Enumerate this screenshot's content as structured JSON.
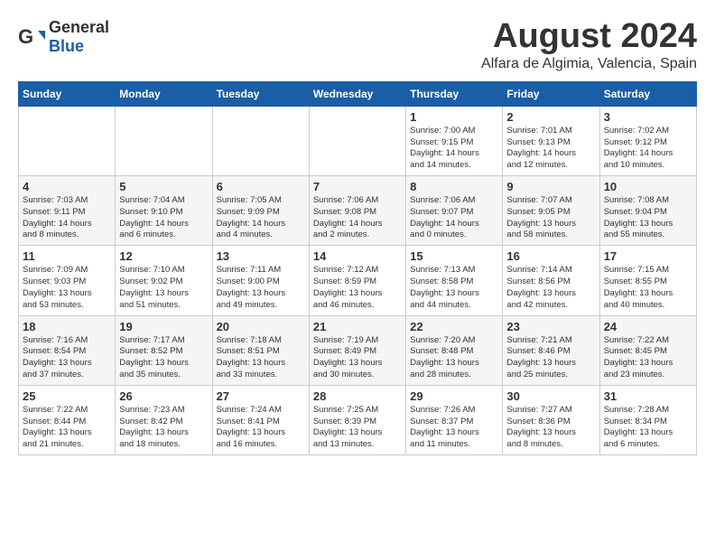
{
  "logo": {
    "general": "General",
    "blue": "Blue"
  },
  "title": "August 2024",
  "location": "Alfara de Algimia, Valencia, Spain",
  "days_header": [
    "Sunday",
    "Monday",
    "Tuesday",
    "Wednesday",
    "Thursday",
    "Friday",
    "Saturday"
  ],
  "weeks": [
    [
      {
        "day": "",
        "info": ""
      },
      {
        "day": "",
        "info": ""
      },
      {
        "day": "",
        "info": ""
      },
      {
        "day": "",
        "info": ""
      },
      {
        "day": "1",
        "info": "Sunrise: 7:00 AM\nSunset: 9:15 PM\nDaylight: 14 hours\nand 14 minutes."
      },
      {
        "day": "2",
        "info": "Sunrise: 7:01 AM\nSunset: 9:13 PM\nDaylight: 14 hours\nand 12 minutes."
      },
      {
        "day": "3",
        "info": "Sunrise: 7:02 AM\nSunset: 9:12 PM\nDaylight: 14 hours\nand 10 minutes."
      }
    ],
    [
      {
        "day": "4",
        "info": "Sunrise: 7:03 AM\nSunset: 9:11 PM\nDaylight: 14 hours\nand 8 minutes."
      },
      {
        "day": "5",
        "info": "Sunrise: 7:04 AM\nSunset: 9:10 PM\nDaylight: 14 hours\nand 6 minutes."
      },
      {
        "day": "6",
        "info": "Sunrise: 7:05 AM\nSunset: 9:09 PM\nDaylight: 14 hours\nand 4 minutes."
      },
      {
        "day": "7",
        "info": "Sunrise: 7:06 AM\nSunset: 9:08 PM\nDaylight: 14 hours\nand 2 minutes."
      },
      {
        "day": "8",
        "info": "Sunrise: 7:06 AM\nSunset: 9:07 PM\nDaylight: 14 hours\nand 0 minutes."
      },
      {
        "day": "9",
        "info": "Sunrise: 7:07 AM\nSunset: 9:05 PM\nDaylight: 13 hours\nand 58 minutes."
      },
      {
        "day": "10",
        "info": "Sunrise: 7:08 AM\nSunset: 9:04 PM\nDaylight: 13 hours\nand 55 minutes."
      }
    ],
    [
      {
        "day": "11",
        "info": "Sunrise: 7:09 AM\nSunset: 9:03 PM\nDaylight: 13 hours\nand 53 minutes."
      },
      {
        "day": "12",
        "info": "Sunrise: 7:10 AM\nSunset: 9:02 PM\nDaylight: 13 hours\nand 51 minutes."
      },
      {
        "day": "13",
        "info": "Sunrise: 7:11 AM\nSunset: 9:00 PM\nDaylight: 13 hours\nand 49 minutes."
      },
      {
        "day": "14",
        "info": "Sunrise: 7:12 AM\nSunset: 8:59 PM\nDaylight: 13 hours\nand 46 minutes."
      },
      {
        "day": "15",
        "info": "Sunrise: 7:13 AM\nSunset: 8:58 PM\nDaylight: 13 hours\nand 44 minutes."
      },
      {
        "day": "16",
        "info": "Sunrise: 7:14 AM\nSunset: 8:56 PM\nDaylight: 13 hours\nand 42 minutes."
      },
      {
        "day": "17",
        "info": "Sunrise: 7:15 AM\nSunset: 8:55 PM\nDaylight: 13 hours\nand 40 minutes."
      }
    ],
    [
      {
        "day": "18",
        "info": "Sunrise: 7:16 AM\nSunset: 8:54 PM\nDaylight: 13 hours\nand 37 minutes."
      },
      {
        "day": "19",
        "info": "Sunrise: 7:17 AM\nSunset: 8:52 PM\nDaylight: 13 hours\nand 35 minutes."
      },
      {
        "day": "20",
        "info": "Sunrise: 7:18 AM\nSunset: 8:51 PM\nDaylight: 13 hours\nand 33 minutes."
      },
      {
        "day": "21",
        "info": "Sunrise: 7:19 AM\nSunset: 8:49 PM\nDaylight: 13 hours\nand 30 minutes."
      },
      {
        "day": "22",
        "info": "Sunrise: 7:20 AM\nSunset: 8:48 PM\nDaylight: 13 hours\nand 28 minutes."
      },
      {
        "day": "23",
        "info": "Sunrise: 7:21 AM\nSunset: 8:46 PM\nDaylight: 13 hours\nand 25 minutes."
      },
      {
        "day": "24",
        "info": "Sunrise: 7:22 AM\nSunset: 8:45 PM\nDaylight: 13 hours\nand 23 minutes."
      }
    ],
    [
      {
        "day": "25",
        "info": "Sunrise: 7:22 AM\nSunset: 8:44 PM\nDaylight: 13 hours\nand 21 minutes."
      },
      {
        "day": "26",
        "info": "Sunrise: 7:23 AM\nSunset: 8:42 PM\nDaylight: 13 hours\nand 18 minutes."
      },
      {
        "day": "27",
        "info": "Sunrise: 7:24 AM\nSunset: 8:41 PM\nDaylight: 13 hours\nand 16 minutes."
      },
      {
        "day": "28",
        "info": "Sunrise: 7:25 AM\nSunset: 8:39 PM\nDaylight: 13 hours\nand 13 minutes."
      },
      {
        "day": "29",
        "info": "Sunrise: 7:26 AM\nSunset: 8:37 PM\nDaylight: 13 hours\nand 11 minutes."
      },
      {
        "day": "30",
        "info": "Sunrise: 7:27 AM\nSunset: 8:36 PM\nDaylight: 13 hours\nand 8 minutes."
      },
      {
        "day": "31",
        "info": "Sunrise: 7:28 AM\nSunset: 8:34 PM\nDaylight: 13 hours\nand 6 minutes."
      }
    ]
  ]
}
